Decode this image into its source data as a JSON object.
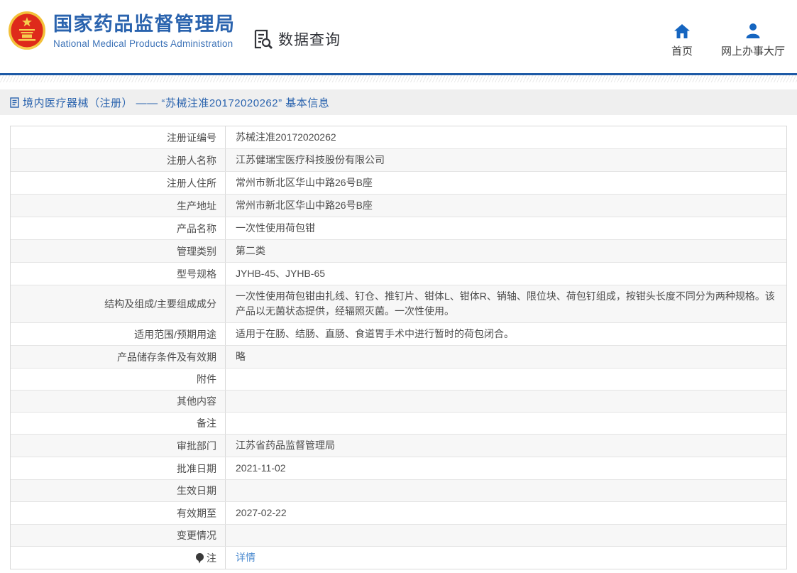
{
  "header": {
    "brand": {
      "title": "国家药品监督管理局",
      "subtitle": "National Medical Products Administration"
    },
    "section": {
      "label": "数据查询"
    },
    "nav": [
      {
        "label": "首页",
        "icon": "home-icon"
      },
      {
        "label": "网上办事大厅",
        "icon": "user-icon"
      }
    ]
  },
  "breadcrumb": {
    "text": "境内医疗器械（注册） —— “苏械注准20172020262” 基本信息"
  },
  "table": {
    "rows": [
      {
        "label": "注册证编号",
        "value": "苏械注准20172020262"
      },
      {
        "label": "注册人名称",
        "value": "江苏健瑞宝医疗科技股份有限公司"
      },
      {
        "label": "注册人住所",
        "value": "常州市新北区华山中路26号B座"
      },
      {
        "label": "生产地址",
        "value": "常州市新北区华山中路26号B座"
      },
      {
        "label": "产品名称",
        "value": "一次性使用荷包钳"
      },
      {
        "label": "管理类别",
        "value": "第二类"
      },
      {
        "label": "型号规格",
        "value": "JYHB-45、JYHB-65"
      },
      {
        "label": "结构及组成/主要组成成分",
        "value": "一次性使用荷包钳由扎线、钉仓、推钉片、钳体L、钳体R、销轴、限位块、荷包钉组成，按钳头长度不同分为两种规格。该产品以无菌状态提供，经辐照灭菌。一次性使用。"
      },
      {
        "label": "适用范围/预期用途",
        "value": "适用于在肠、结肠、直肠、食道胃手术中进行暂时的荷包闭合。"
      },
      {
        "label": "产品储存条件及有效期",
        "value": "略"
      },
      {
        "label": "附件",
        "value": ""
      },
      {
        "label": "其他内容",
        "value": ""
      },
      {
        "label": "备注",
        "value": ""
      },
      {
        "label": "审批部门",
        "value": "江苏省药品监督管理局"
      },
      {
        "label": "批准日期",
        "value": "2021-11-02"
      },
      {
        "label": "生效日期",
        "value": ""
      },
      {
        "label": "有效期至",
        "value": "2027-02-22"
      },
      {
        "label": "变更情况",
        "value": ""
      },
      {
        "label": "注",
        "value": "详情",
        "value_is_link": true,
        "icon": "bulb"
      }
    ]
  },
  "colors": {
    "brand_blue": "#2a63ae",
    "accent_line": "#1e5aa6",
    "link_blue": "#4e8cd0",
    "nav_icon_blue": "#1565c0",
    "breadcrumb_bg": "#efefef",
    "row_alt_bg": "#f7f7f7",
    "emblem_red": "#de2a1b",
    "emblem_gold": "#f3c13a"
  }
}
